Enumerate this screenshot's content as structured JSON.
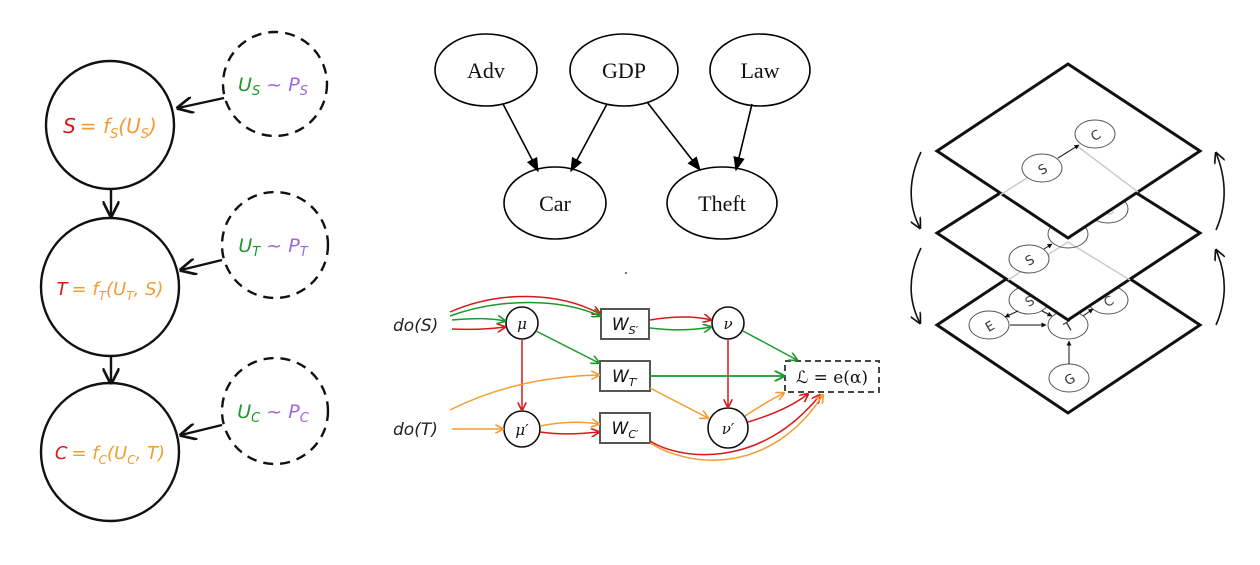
{
  "colors": {
    "red": "#d7191c",
    "orange": "#f39c32",
    "green": "#1a9a2a",
    "purple": "#a066e0",
    "black": "#111111",
    "grey": "#cccccc",
    "dash_grey": "#444444"
  },
  "scm_panel": {
    "nodes": [
      {
        "id": "S",
        "lhs": "S",
        "rhs": "= f",
        "sub": "S",
        "args": "(U",
        "args_sub": "S",
        "close": ")"
      },
      {
        "id": "T",
        "lhs": "T",
        "rhs": "= f",
        "sub": "T",
        "args": "(U",
        "args_sub": "T",
        "close": ", S)"
      },
      {
        "id": "C",
        "lhs": "C",
        "rhs": "= f",
        "sub": "C",
        "args": "(U",
        "args_sub": "C",
        "close": ", T)"
      }
    ],
    "noise": [
      {
        "id": "US",
        "u": "U",
        "u_sub": "S",
        "tilde": " ~ ",
        "p": "P",
        "p_sub": "S"
      },
      {
        "id": "UT",
        "u": "U",
        "u_sub": "T",
        "tilde": " ~ ",
        "p": "P",
        "p_sub": "T"
      },
      {
        "id": "UC",
        "u": "U",
        "u_sub": "C",
        "tilde": " ~ ",
        "p": "P",
        "p_sub": "C"
      }
    ]
  },
  "bayes_panel": {
    "nodes": [
      "Adv",
      "GDP",
      "Law",
      "Car",
      "Theft"
    ],
    "edges": [
      [
        "Adv",
        "Car"
      ],
      [
        "GDP",
        "Car"
      ],
      [
        "GDP",
        "Theft"
      ],
      [
        "Law",
        "Theft"
      ]
    ]
  },
  "flow_panel": {
    "interventions": {
      "doS": "do(S)",
      "doT": "do(T)"
    },
    "circles": {
      "mu": "μ",
      "mu_p": "μ′",
      "nu": "ν",
      "nu_p": "ν′"
    },
    "boxes": {
      "WS": {
        "base": "W",
        "sub": "S′"
      },
      "WT": {
        "base": "W",
        "sub": "T′"
      },
      "WC": {
        "base": "W",
        "sub": "C′"
      }
    },
    "loss": "ℒ = e(α)"
  },
  "layers_panel": {
    "top_layer": {
      "nodes": [
        "S",
        "C"
      ]
    },
    "middle_layer": {
      "nodes": [
        "S",
        "T",
        "C"
      ]
    },
    "bottom_layer": {
      "nodes": [
        "S",
        "E",
        "T",
        "C",
        "G"
      ]
    }
  }
}
